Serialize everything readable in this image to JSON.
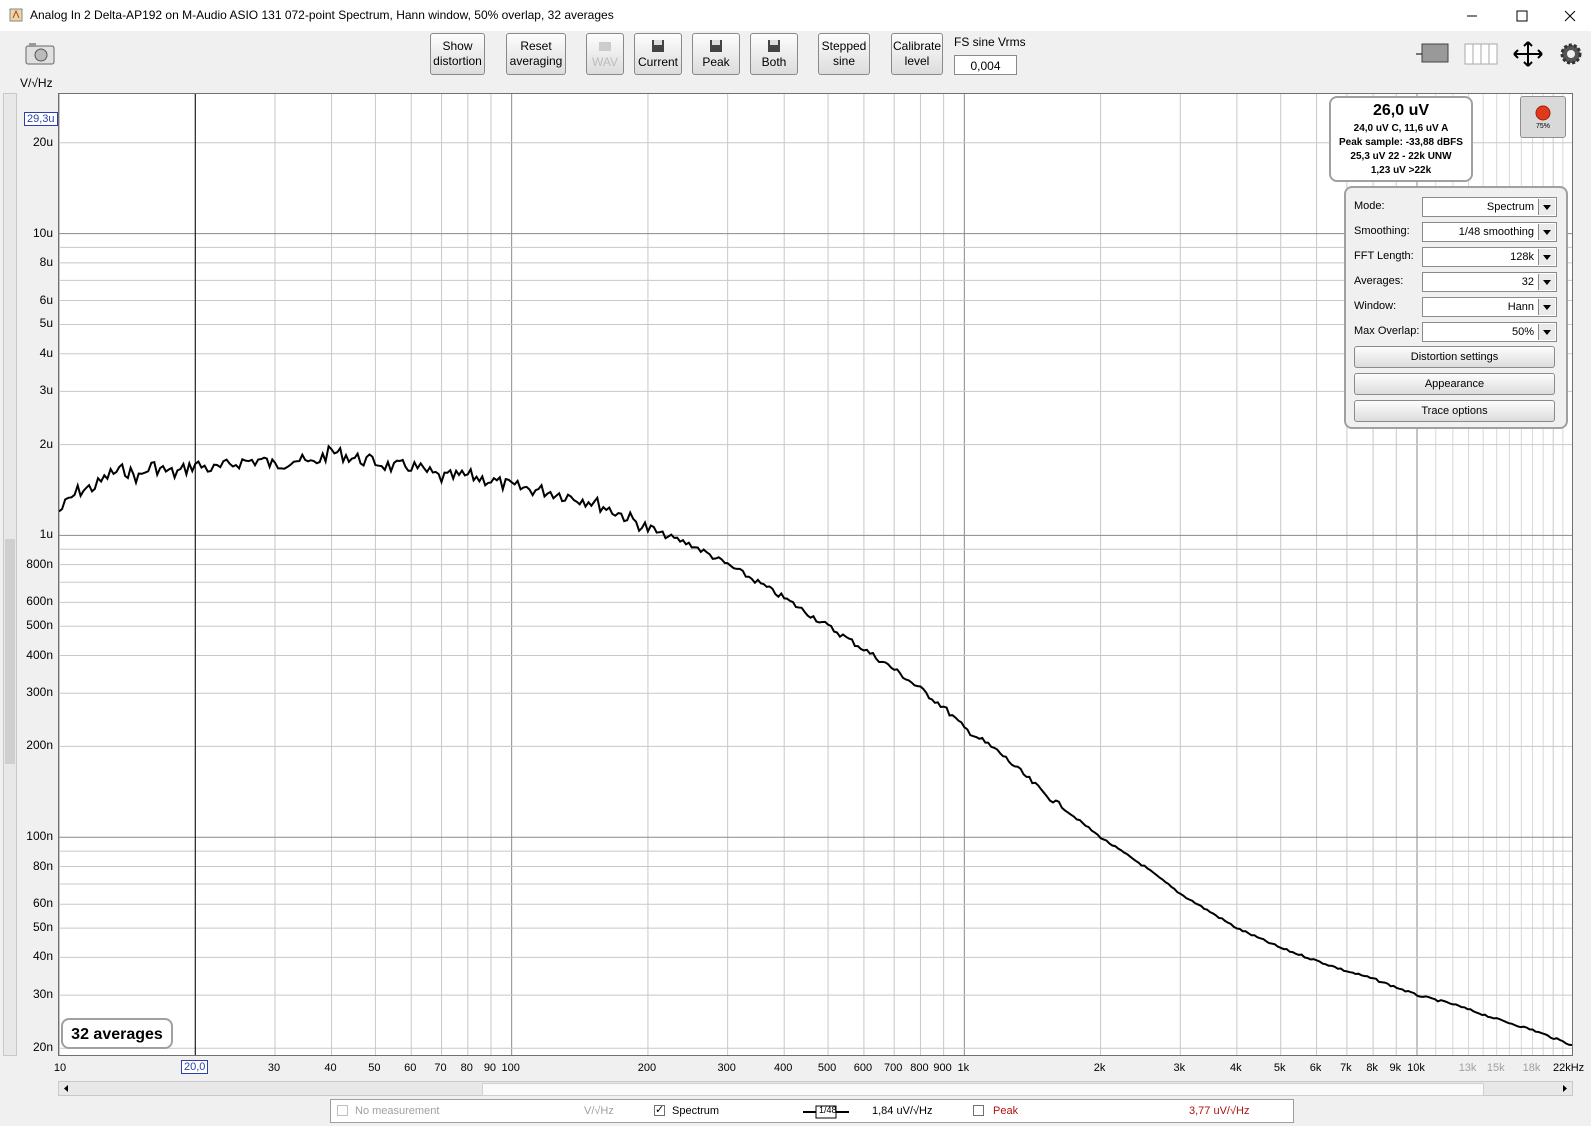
{
  "window": {
    "title": "Analog In 2 Delta-AP192 on M-Audio ASIO 131 072-point Spectrum, Hann window, 50% overlap, 32 averages"
  },
  "toolbar": {
    "show_distortion": [
      "Show",
      "distortion"
    ],
    "reset_averaging": [
      "Reset",
      "averaging"
    ],
    "wav": "WAV",
    "current": "Current",
    "peak": "Peak",
    "both": "Both",
    "stepped_sine": [
      "Stepped",
      "sine"
    ],
    "calibrate_level": [
      "Calibrate",
      "level"
    ],
    "fs_label": "FS sine Vrms",
    "fs_value": "0,004"
  },
  "units": "V/√Hz",
  "cursor": {
    "y": "29,3u",
    "x": "20,0"
  },
  "y_ticks": [
    "20u",
    "10u",
    "8u",
    "6u",
    "5u",
    "4u",
    "3u",
    "2u",
    "1u",
    "800n",
    "600n",
    "500n",
    "400n",
    "300n",
    "200n",
    "100n",
    "80n",
    "60n",
    "50n",
    "40n",
    "30n",
    "20n"
  ],
  "x_ticks": [
    "10",
    "30",
    "40",
    "50",
    "60",
    "70",
    "80",
    "90",
    "100",
    "200",
    "300",
    "400",
    "500",
    "600",
    "700",
    "800",
    "900",
    "1k",
    "2k",
    "3k",
    "4k",
    "5k",
    "6k",
    "7k",
    "8k",
    "9k",
    "10k"
  ],
  "x_ticks_grey": [
    "13k",
    "15k",
    "18k"
  ],
  "x_last": "22kHz",
  "rms": {
    "main": "26,0 uV",
    "weighted": "24,0 uV C, 11,6 uV A",
    "peak_sample": "Peak sample: -33,88 dBFS",
    "unw": "25,3 uV 22 - 22k UNW",
    "above": "1,23 uV >22k"
  },
  "record": {
    "percent": "75%"
  },
  "panel": {
    "mode": {
      "label": "Mode:",
      "value": "Spectrum"
    },
    "smoothing": {
      "label": "Smoothing:",
      "value": "1/48 smoothing"
    },
    "fft": {
      "label": "FFT Length:",
      "value": "128k"
    },
    "averages": {
      "label": "Averages:",
      "value": "32"
    },
    "window": {
      "label": "Window:",
      "value": "Hann"
    },
    "overlap": {
      "label": "Max Overlap:",
      "value": "50%"
    },
    "distortion_settings": "Distortion settings",
    "appearance": "Appearance",
    "trace_options": "Trace options"
  },
  "averages_badge": "32 averages",
  "legend": {
    "no_measurement": "No measurement",
    "units1": "V/√Hz",
    "spectrum": "Spectrum",
    "smoothing_badge": "1/48",
    "spectrum_value": "1,84 uV/√Hz",
    "peak": "Peak",
    "peak_value": "3,77 uV/√Hz"
  },
  "chart_data": {
    "type": "line",
    "title": "",
    "xlabel": "Hz",
    "ylabel": "V/√Hz",
    "x_scale": "log",
    "y_scale": "log",
    "xlim": [
      10,
      22000
    ],
    "ylim": [
      1.9e-08,
      2.9e-05
    ],
    "grid": true,
    "series": [
      {
        "name": "Spectrum",
        "color": "#000000",
        "x": [
          10,
          11,
          12,
          13,
          14,
          15,
          16,
          18,
          20,
          22,
          25,
          28,
          30,
          33,
          36,
          40,
          45,
          50,
          55,
          60,
          65,
          70,
          80,
          90,
          100,
          120,
          150,
          180,
          200,
          250,
          300,
          350,
          400,
          500,
          600,
          700,
          800,
          900,
          1000,
          1200,
          1500,
          2000,
          2500,
          3000,
          4000,
          5000,
          6000,
          7000,
          8000,
          10000,
          12000,
          15000,
          18000,
          22000
        ],
        "y": [
          1.2e-06,
          1.4e-06,
          1.45e-06,
          1.6e-06,
          1.65e-06,
          1.55e-06,
          1.7e-06,
          1.6e-06,
          1.72e-06,
          1.65e-06,
          1.75e-06,
          1.78e-06,
          1.7e-06,
          1.8e-06,
          1.72e-06,
          1.9e-06,
          1.8e-06,
          1.75e-06,
          1.68e-06,
          1.7e-06,
          1.62e-06,
          1.55e-06,
          1.58e-06,
          1.52e-06,
          1.45e-06,
          1.4e-06,
          1.3e-06,
          1.15e-06,
          1.05e-06,
          9.3e-07,
          8e-07,
          7e-07,
          6.2e-07,
          5e-07,
          4.2e-07,
          3.6e-07,
          3.1e-07,
          2.7e-07,
          2.3e-07,
          1.9e-07,
          1.4e-07,
          1e-07,
          8e-08,
          6.5e-08,
          5e-08,
          4.3e-08,
          3.9e-08,
          3.6e-08,
          3.4e-08,
          3e-08,
          2.8e-08,
          2.5e-08,
          2.3e-08,
          2.05e-08
        ]
      }
    ]
  }
}
